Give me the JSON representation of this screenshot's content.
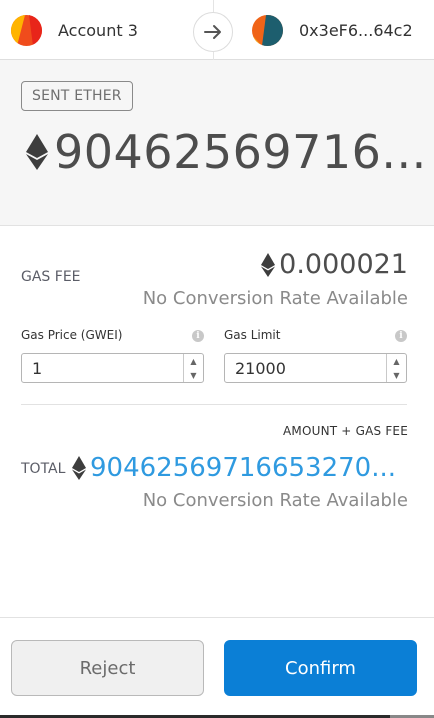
{
  "header": {
    "from_account": {
      "name": "Account 3",
      "avatar_colors": [
        "#f04c1c",
        "#ffb400",
        "#e8251a"
      ]
    },
    "arrow_icon": "arrow-right-icon",
    "to_account": {
      "name": "0x3eF6...64c2",
      "avatar_colors": [
        "#f06418",
        "#1d5e6e",
        "#f2a51b"
      ]
    }
  },
  "summary": {
    "tag": "SENT ETHER",
    "amount": "90462569716..."
  },
  "gas": {
    "label": "GAS FEE",
    "fee": "0.000021",
    "conversion": "No Conversion Rate Available",
    "price_label": "Gas Price (GWEI)",
    "price_value": "1",
    "limit_label": "Gas Limit",
    "limit_value": "21000",
    "info_icon": "i"
  },
  "total": {
    "caption": "AMOUNT + GAS FEE",
    "label": "TOTAL",
    "value": "90462569716653270...",
    "conversion": "No Conversion Rate Available"
  },
  "footer": {
    "reject_label": "Reject",
    "confirm_label": "Confirm"
  },
  "colors": {
    "confirm": "#0b7fd6",
    "total_value": "#2f9ae0",
    "summary_bg": "#f6f6f6"
  }
}
